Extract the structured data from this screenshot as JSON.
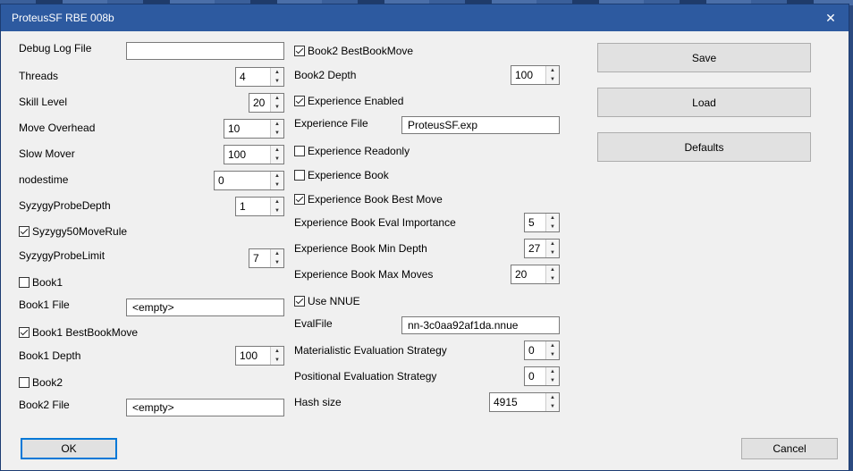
{
  "window": {
    "title": "ProteusSF RBE 008b"
  },
  "left": {
    "debug_log_file": {
      "label": "Debug Log File",
      "value": ""
    },
    "threads": {
      "label": "Threads",
      "value": "4"
    },
    "skill_level": {
      "label": "Skill Level",
      "value": "20"
    },
    "move_overhead": {
      "label": "Move Overhead",
      "value": "10"
    },
    "slow_mover": {
      "label": "Slow Mover",
      "value": "100"
    },
    "nodestime": {
      "label": "nodestime",
      "value": "0"
    },
    "syzygy_probe_depth": {
      "label": "SyzygyProbeDepth",
      "value": "1"
    },
    "syzygy50": {
      "label": "Syzygy50MoveRule",
      "checked": true
    },
    "syzygy_probe_limit": {
      "label": "SyzygyProbeLimit",
      "value": "7"
    },
    "book1": {
      "label": "Book1",
      "checked": false
    },
    "book1_file": {
      "label": "Book1 File",
      "value": "<empty>"
    },
    "book1_best": {
      "label": "Book1 BestBookMove",
      "checked": true
    },
    "book1_depth": {
      "label": "Book1 Depth",
      "value": "100"
    },
    "book2": {
      "label": "Book2",
      "checked": false
    },
    "book2_file": {
      "label": "Book2 File",
      "value": "<empty>"
    }
  },
  "middle": {
    "book2_best": {
      "label": "Book2 BestBookMove",
      "checked": true
    },
    "book2_depth": {
      "label": "Book2 Depth",
      "value": "100"
    },
    "exp_enabled": {
      "label": "Experience Enabled",
      "checked": true
    },
    "exp_file": {
      "label": "Experience File",
      "value": "ProteusSF.exp"
    },
    "exp_readonly": {
      "label": "Experience Readonly",
      "checked": false
    },
    "exp_book": {
      "label": "Experience Book",
      "checked": false
    },
    "exp_book_best": {
      "label": "Experience Book Best Move",
      "checked": true
    },
    "exp_eval_importance": {
      "label": "Experience Book Eval Importance",
      "value": "5"
    },
    "exp_min_depth": {
      "label": "Experience Book Min Depth",
      "value": "27"
    },
    "exp_max_moves": {
      "label": "Experience Book Max Moves",
      "value": "20"
    },
    "use_nnue": {
      "label": "Use NNUE",
      "checked": true
    },
    "evalfile": {
      "label": "EvalFile",
      "value": "nn-3c0aa92af1da.nnue"
    },
    "materialistic": {
      "label": "Materialistic Evaluation Strategy",
      "value": "0"
    },
    "positional": {
      "label": "Positional Evaluation Strategy",
      "value": "0"
    },
    "hash": {
      "label": "Hash size",
      "value": "4915"
    }
  },
  "right": {
    "save": "Save",
    "load": "Load",
    "defaults": "Defaults"
  },
  "footer": {
    "ok": "OK",
    "cancel": "Cancel"
  }
}
